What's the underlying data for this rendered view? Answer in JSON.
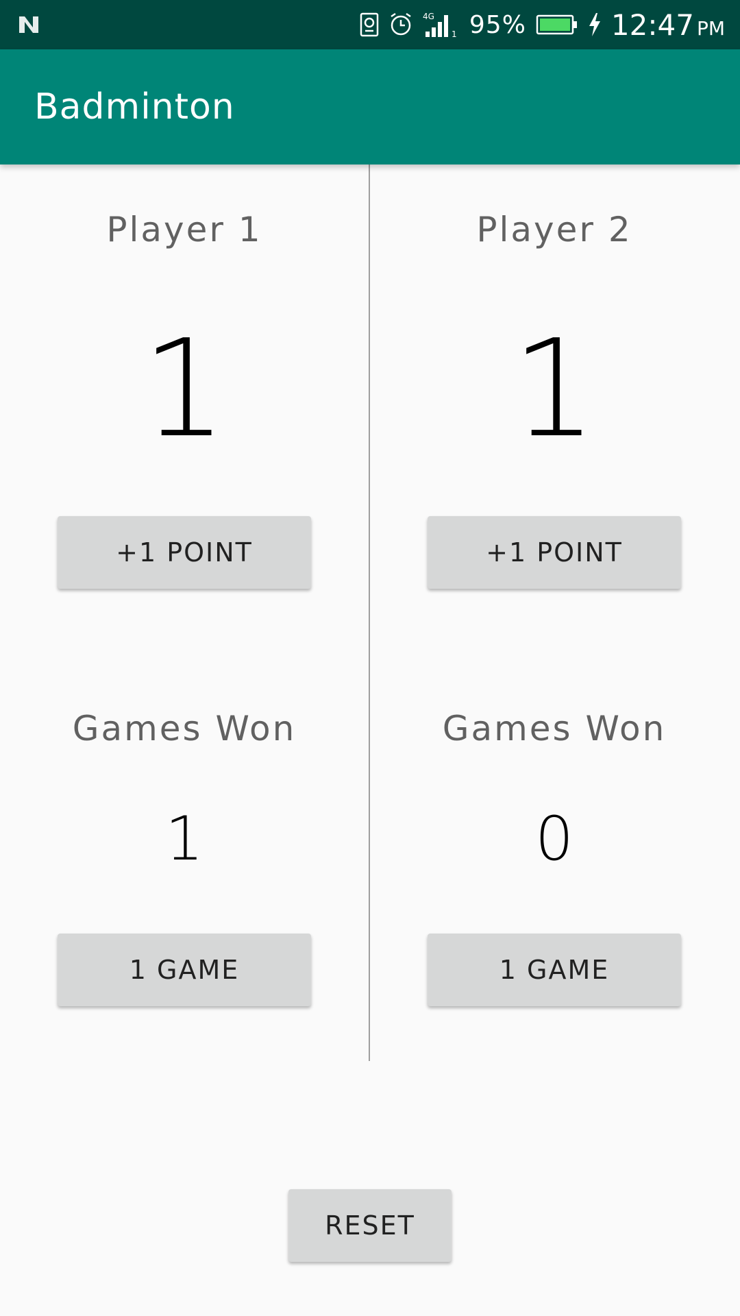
{
  "status_bar": {
    "battery_percent": "95%",
    "time": "12:47",
    "ampm": "PM",
    "icons": [
      "notification-n-icon",
      "sim-card-icon",
      "alarm-icon",
      "signal-4g-icon",
      "battery-icon",
      "charging-bolt-icon"
    ],
    "battery_color": "#4cd964"
  },
  "app_bar": {
    "title": "Badminton",
    "color": "#008577"
  },
  "players": [
    {
      "name": "Player 1",
      "score": "1",
      "point_button": "+1 POINT",
      "games_label": "Games Won",
      "games_won": "1",
      "game_button": "1 GAME"
    },
    {
      "name": "Player 2",
      "score": "1",
      "point_button": "+1 POINT",
      "games_label": "Games Won",
      "games_won": "0",
      "game_button": "1 GAME"
    }
  ],
  "reset_button": "RESET"
}
